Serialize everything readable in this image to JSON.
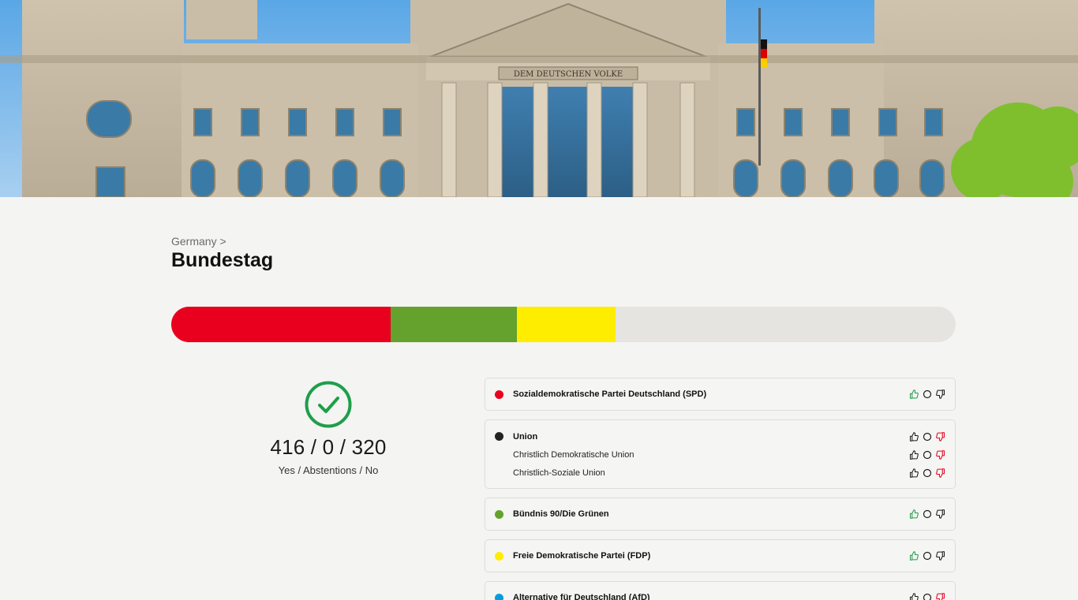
{
  "breadcrumb": {
    "country": "Germany",
    "separator": ">"
  },
  "page_title": "Bundestag",
  "hero": {
    "inscription": "DEM DEUTSCHEN VOLKE"
  },
  "vote_bar": {
    "segments": [
      {
        "color": "#e8001e",
        "fraction": 0.28
      },
      {
        "color": "#64a12d",
        "fraction": 0.161
      },
      {
        "color": "#ffed00",
        "fraction": 0.125
      }
    ],
    "track_color": "#e5e4e1"
  },
  "result": {
    "status_icon": "check-circle-icon",
    "status_color": "#1e9e4a",
    "tally": "416 / 0 / 320",
    "caption": "Yes / Abstentions / No"
  },
  "parties": [
    {
      "name": "Sozialdemokratische Partei Deutschland (SPD)",
      "color": "#e8001e",
      "vote": "yes",
      "subparties": []
    },
    {
      "name": "Union",
      "color": "#222222",
      "vote": "no",
      "subparties": [
        {
          "name": "Christlich Demokratische Union",
          "vote": "no"
        },
        {
          "name": "Christlich-Soziale Union",
          "vote": "no"
        }
      ]
    },
    {
      "name": "Bündnis 90/Die Grünen",
      "color": "#64a12d",
      "vote": "yes",
      "subparties": []
    },
    {
      "name": "Freie Demokratische Partei (FDP)",
      "color": "#ffed00",
      "vote": "yes",
      "subparties": []
    },
    {
      "name": "Alternative für Deutschland (AfD)",
      "color": "#009ee0",
      "vote": "no",
      "subparties": []
    }
  ],
  "icons": {
    "yes": "thumbs-up-icon",
    "abstain": "circle-icon",
    "no": "thumbs-down-icon"
  },
  "colors": {
    "yes_active": "#1e9e4a",
    "no_active": "#e8001e",
    "inactive": "#1a1a1a"
  }
}
